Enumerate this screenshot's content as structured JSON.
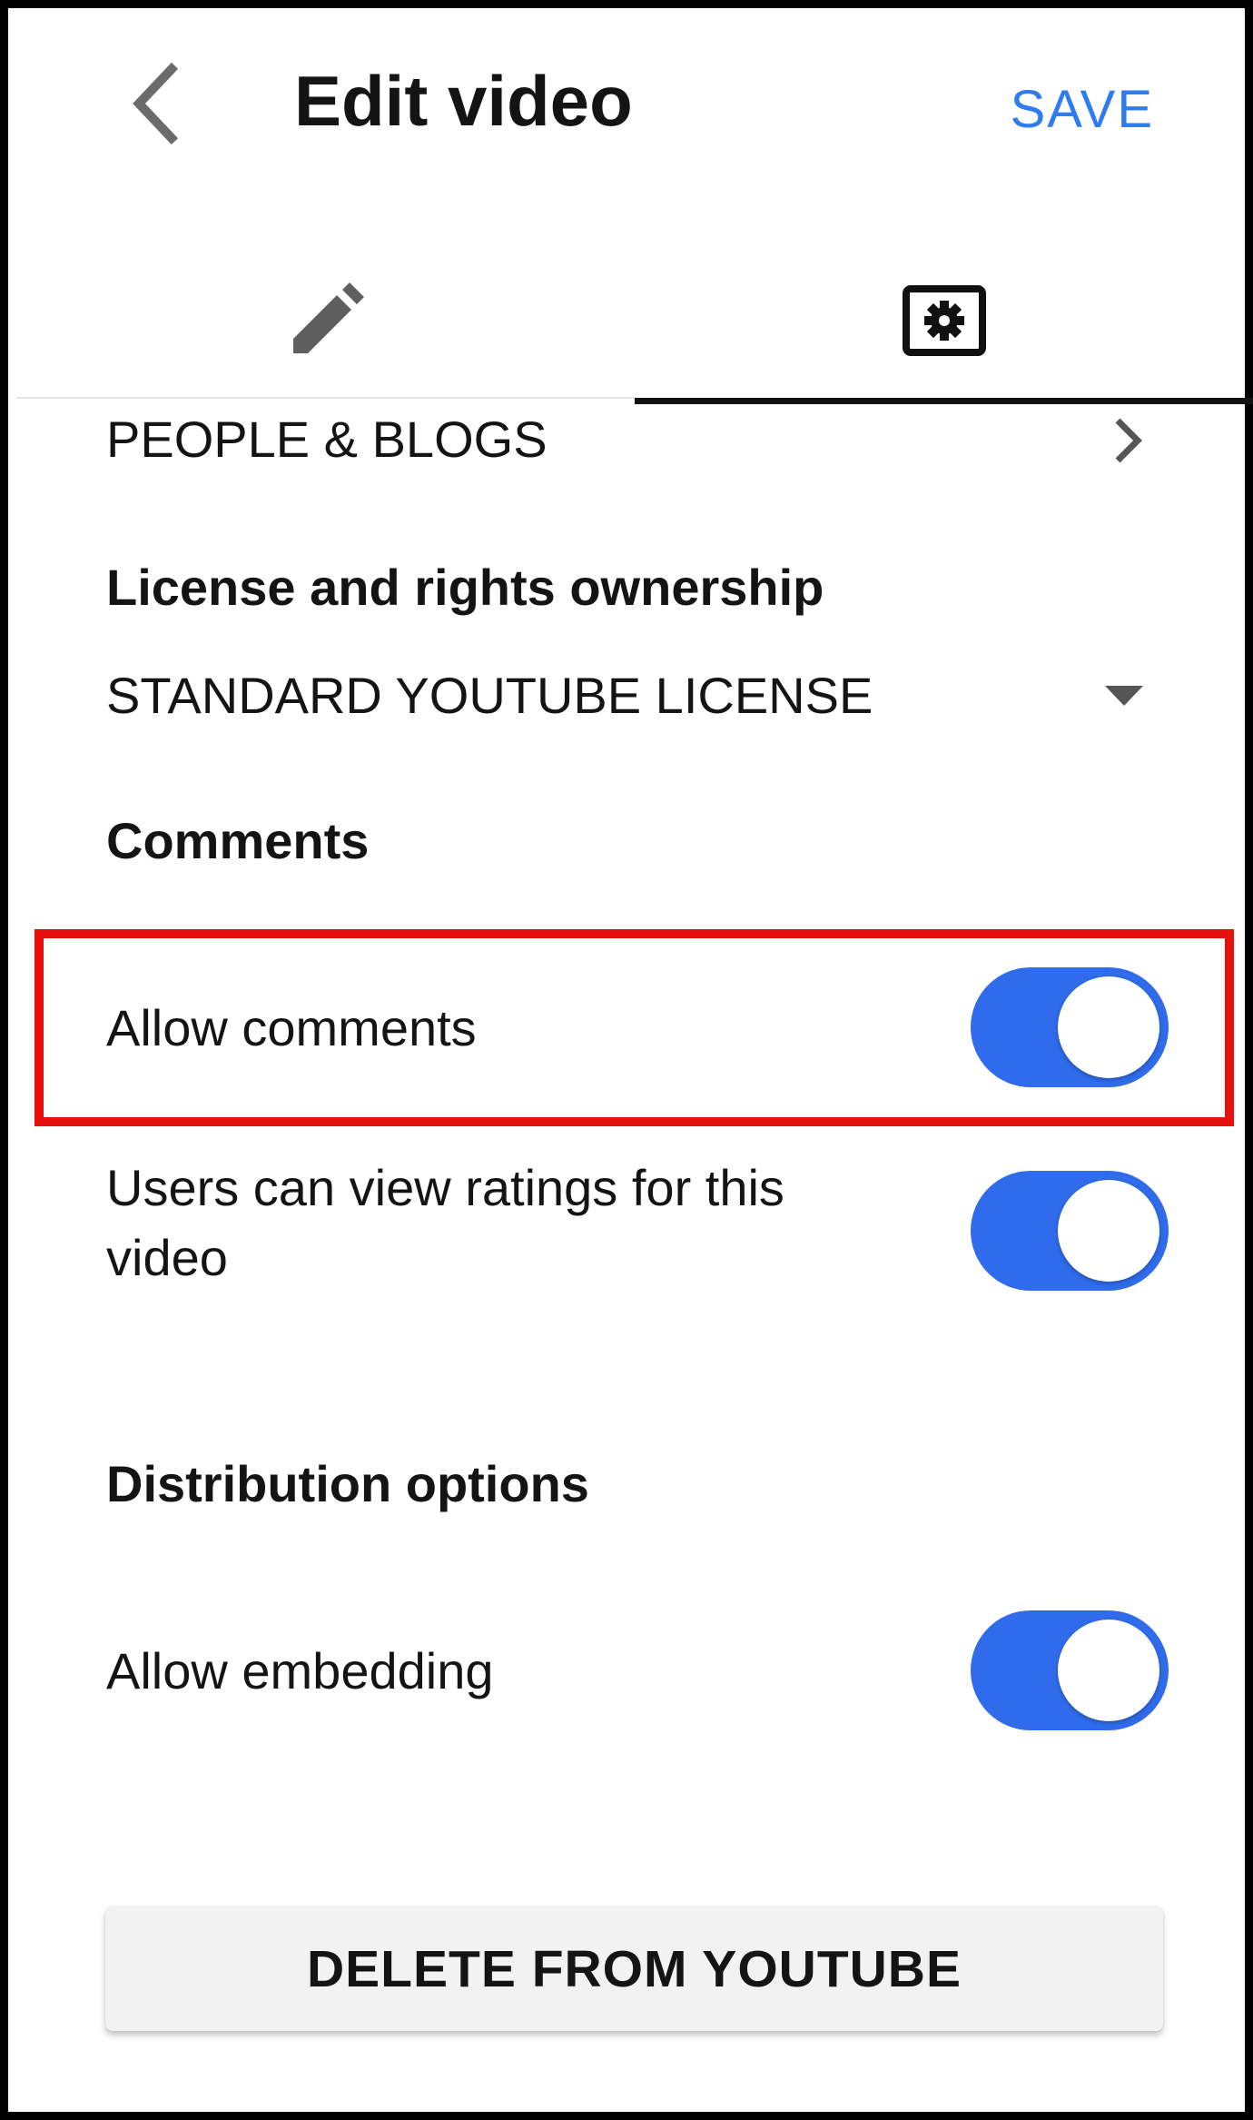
{
  "header": {
    "back_icon": "chevron-left-icon",
    "title": "Edit video",
    "save_label": "SAVE"
  },
  "tabs": [
    {
      "icon": "pencil-icon",
      "selected": false
    },
    {
      "icon": "settings-icon",
      "selected": true
    }
  ],
  "category": {
    "value": "PEOPLE & BLOGS",
    "icon": "chevron-right-icon"
  },
  "license": {
    "heading": "License and rights ownership",
    "value": "STANDARD YOUTUBE LICENSE",
    "icon": "dropdown-caret-icon"
  },
  "comments": {
    "heading": "Comments",
    "allow_comments": {
      "label": "Allow comments",
      "on": true
    },
    "view_ratings": {
      "label": "Users can view ratings for this video",
      "on": true
    }
  },
  "distribution": {
    "heading": "Distribution options",
    "allow_embedding": {
      "label": "Allow embedding",
      "on": true
    }
  },
  "delete_label": "DELETE FROM YOUTUBE",
  "colors": {
    "accent": "#2f7bf0",
    "toggle_on": "#2f6bea",
    "highlight": "#e8100c"
  }
}
